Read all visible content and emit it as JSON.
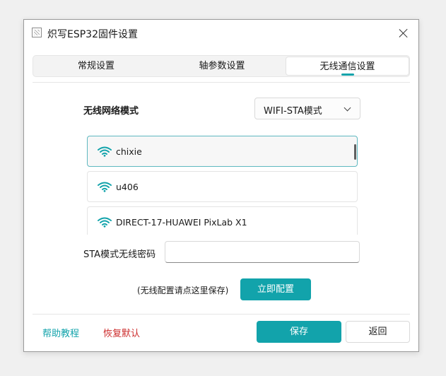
{
  "window": {
    "title": "炽写ESP32固件设置"
  },
  "tabs": [
    {
      "label": "常规设置"
    },
    {
      "label": "轴参数设置"
    },
    {
      "label": "无线通信设置"
    }
  ],
  "wireless": {
    "mode_label": "无线网络模式",
    "mode_value": "WIFI-STA模式",
    "networks": [
      {
        "ssid": "chixie",
        "icon": "wifi-icon"
      },
      {
        "ssid": "u406",
        "icon": "wifi-icon"
      },
      {
        "ssid": "DIRECT-17-HUAWEI PixLab X1",
        "icon": "wifi-icon"
      }
    ],
    "password_label": "STA模式无线密码",
    "password_value": "",
    "hint": "(无线配置请点这里保存)",
    "config_button": "立即配置"
  },
  "footer": {
    "help_link": "帮助教程",
    "reset_link": "恢复默认",
    "save_button": "保存",
    "back_button": "返回"
  },
  "colors": {
    "accent": "#12a3ab",
    "danger": "#cc2b2b",
    "selected_border": "#5fb8c0"
  }
}
